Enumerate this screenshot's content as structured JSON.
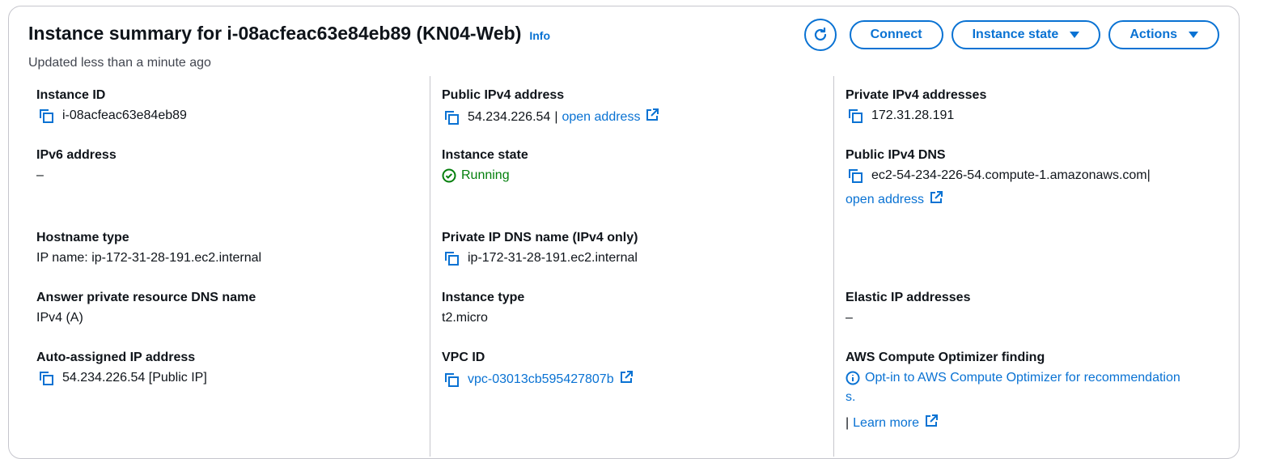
{
  "header": {
    "title": "Instance summary for i-08acfeac63e84eb89 (KN04-Web)",
    "info": "Info",
    "subtitle": "Updated less than a minute ago",
    "buttons": {
      "connect": "Connect",
      "instance_state": "Instance state",
      "actions": "Actions"
    }
  },
  "fields": {
    "instance_id": {
      "label": "Instance ID",
      "value": "i-08acfeac63e84eb89"
    },
    "public_ipv4": {
      "label": "Public IPv4 address",
      "value": "54.234.226.54",
      "sep": "|",
      "link": "open address"
    },
    "private_ipv4": {
      "label": "Private IPv4 addresses",
      "value": "172.31.28.191"
    },
    "ipv6": {
      "label": "IPv6 address",
      "value": "–"
    },
    "instance_state": {
      "label": "Instance state",
      "value": "Running"
    },
    "public_dns": {
      "label": "Public IPv4 DNS",
      "value": "ec2-54-234-226-54.compute-1.amazonaws.com",
      "sep": "|",
      "link": "open address"
    },
    "hostname_type": {
      "label": "Hostname type",
      "value": "IP name: ip-172-31-28-191.ec2.internal"
    },
    "private_dns": {
      "label": "Private IP DNS name (IPv4 only)",
      "value": "ip-172-31-28-191.ec2.internal"
    },
    "answer_dns": {
      "label": "Answer private resource DNS name",
      "value": "IPv4 (A)"
    },
    "instance_type": {
      "label": "Instance type",
      "value": "t2.micro"
    },
    "elastic_ip": {
      "label": "Elastic IP addresses",
      "value": "–"
    },
    "auto_ip": {
      "label": "Auto-assigned IP address",
      "value": "54.234.226.54 [Public IP]"
    },
    "vpc_id": {
      "label": "VPC ID",
      "value": "vpc-03013cb595427807b"
    },
    "optimizer": {
      "label": "AWS Compute Optimizer finding",
      "link": "Opt-in to AWS Compute Optimizer for recommendation",
      "link_tail": "s.",
      "sep": "|",
      "learn": "Learn more"
    }
  },
  "colors": {
    "link": "#0972d3",
    "success": "#037f0c",
    "border": "#c6c6cd"
  }
}
